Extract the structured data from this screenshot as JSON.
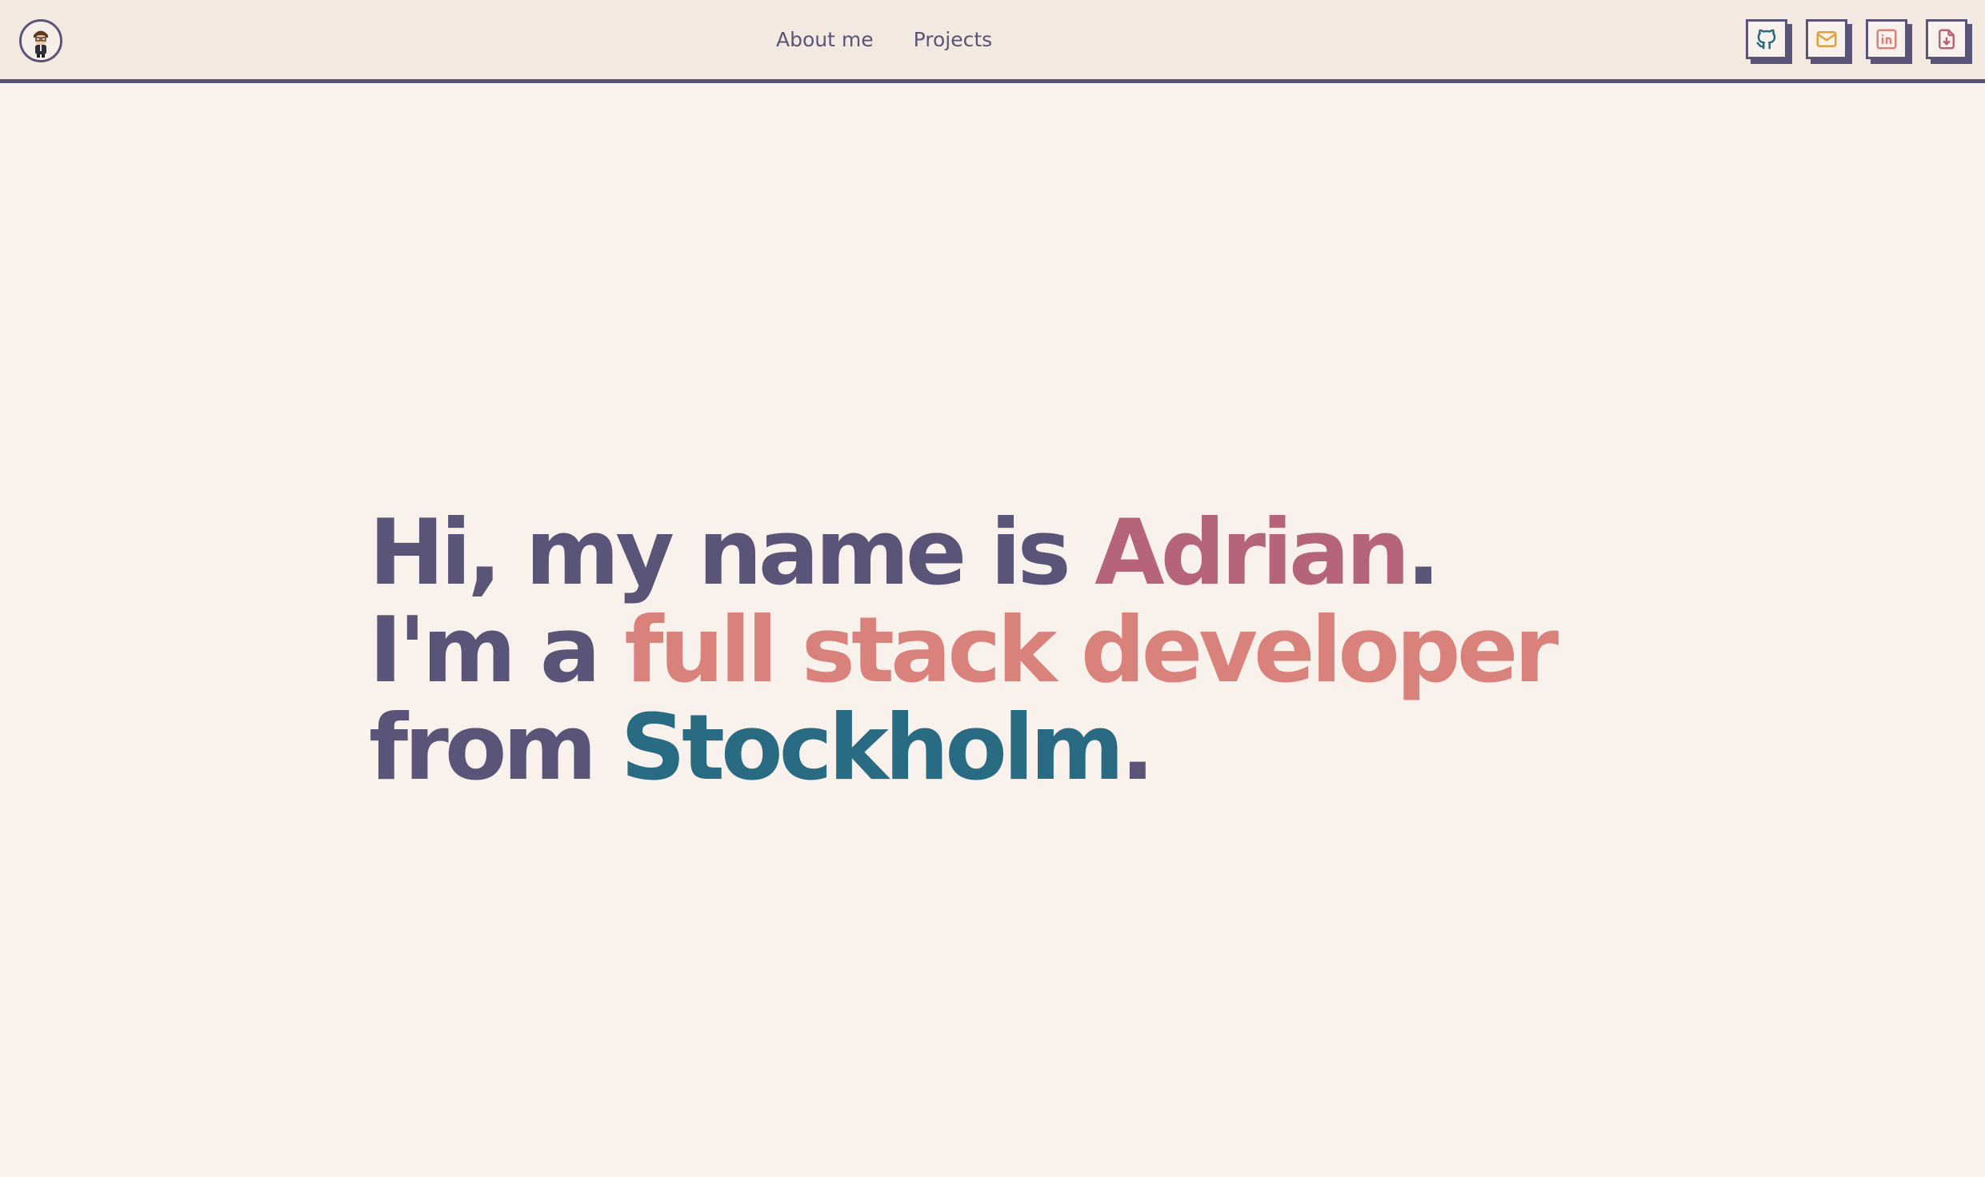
{
  "nav": {
    "links": [
      {
        "label": "About me"
      },
      {
        "label": "Projects"
      }
    ],
    "social": [
      {
        "icon": "github-icon",
        "color": "#2a6b84"
      },
      {
        "icon": "mail-icon",
        "color": "#e0a03a"
      },
      {
        "icon": "linkedin-icon",
        "color": "#d9817b"
      },
      {
        "icon": "download-file-icon",
        "color": "#b5647a"
      }
    ]
  },
  "hero": {
    "line1_prefix": "Hi, my name is ",
    "name": "Adrian",
    "line1_suffix": ".",
    "line2_prefix": "I'm a ",
    "role": "full stack developer",
    "line3_prefix": "from ",
    "city": "Stockholm",
    "line3_suffix": "."
  },
  "colors": {
    "primary": "#5a5478",
    "name": "#b5647a",
    "role": "#d9817b",
    "city": "#2a6b84",
    "background": "#f9f1ec",
    "navbar": "#f3e9e0"
  }
}
